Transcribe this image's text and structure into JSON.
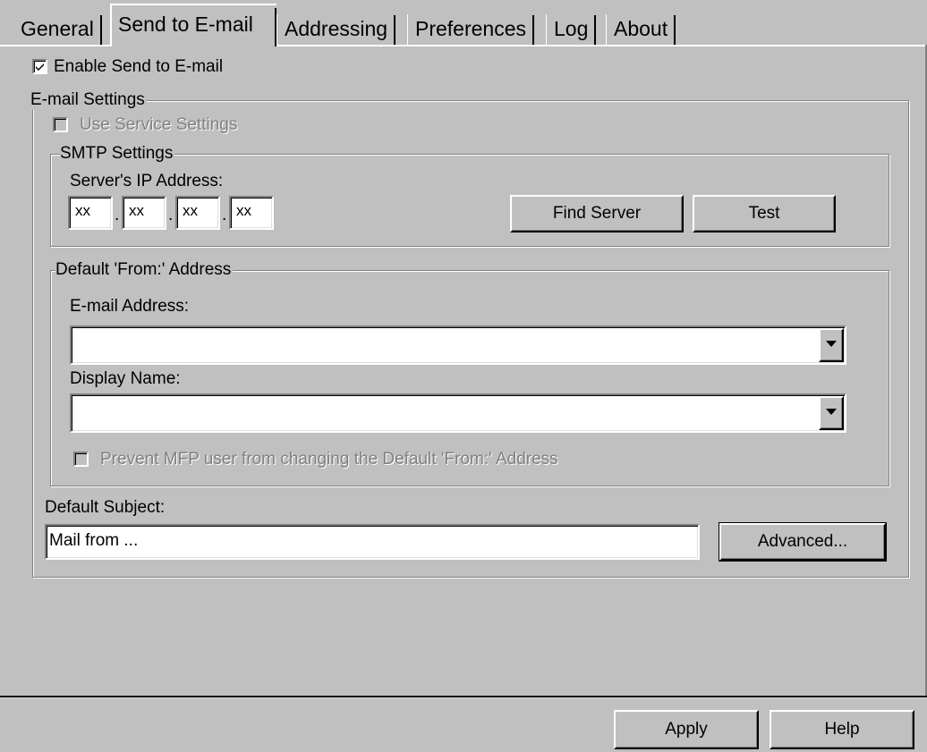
{
  "tabs": [
    {
      "label": "General"
    },
    {
      "label": "Send to E-mail"
    },
    {
      "label": "Addressing"
    },
    {
      "label": "Preferences"
    },
    {
      "label": "Log"
    },
    {
      "label": "About"
    }
  ],
  "enable_send_to_email": {
    "label": "Enable Send to E-mail",
    "checked": true
  },
  "email_settings": {
    "legend": "E-mail Settings",
    "use_service_settings": {
      "label": "Use Service Settings",
      "checked": false,
      "disabled": true
    },
    "smtp": {
      "legend": "SMTP Settings",
      "server_ip_label": "Server's IP Address:",
      "ip_octets": [
        "xx",
        "xx",
        "xx",
        "xx"
      ],
      "dot": ".",
      "find_server_label": "Find Server",
      "test_label": "Test"
    },
    "default_from": {
      "legend": "Default 'From:' Address",
      "email_address_label": "E-mail Address:",
      "email_address_value": "",
      "display_name_label": "Display Name:",
      "display_name_value": "",
      "prevent_change": {
        "label": "Prevent MFP user from changing the Default 'From:' Address",
        "checked": false,
        "disabled": true
      }
    },
    "default_subject_label": "Default Subject:",
    "default_subject_value": "Mail from ...",
    "advanced_label": "Advanced..."
  },
  "footer": {
    "apply_label": "Apply",
    "help_label": "Help"
  },
  "icons": {
    "check": "checkmark-icon",
    "dropdown": "chevron-down-icon"
  }
}
